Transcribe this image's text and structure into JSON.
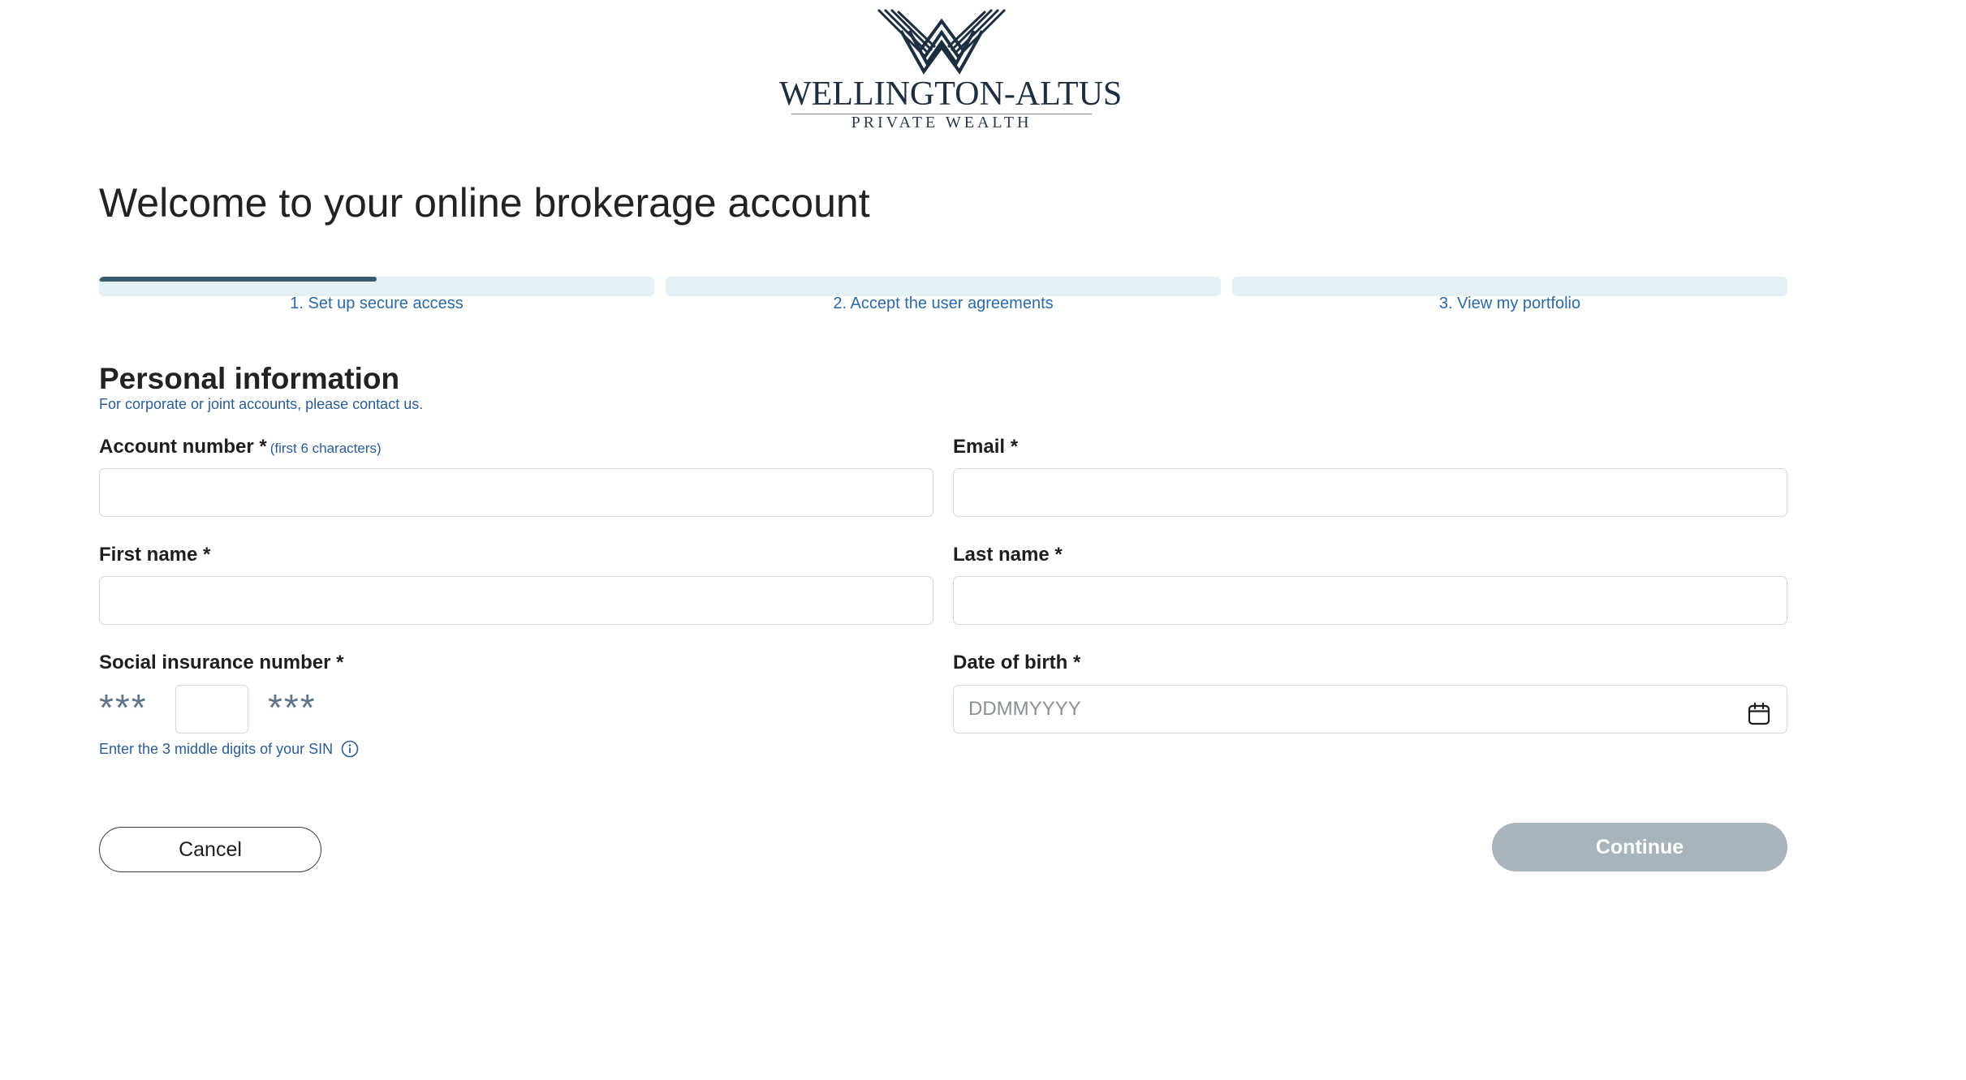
{
  "brand": {
    "name": "WELLINGTON-ALTUS",
    "tagline": "PRIVATE WEALTH",
    "logo_icon": "interlaced-chevron-logo",
    "color_primary": "#1c2e40"
  },
  "page": {
    "title": "Welcome to your online brokerage account"
  },
  "stepper": {
    "progress_color": "#3c5a6e",
    "track_color": "#e4f1f4",
    "steps": [
      {
        "label": "1. Set up secure access",
        "progress": 0.5
      },
      {
        "label": "2. Accept the user agreements",
        "progress": 0
      },
      {
        "label": "3. View my portfolio",
        "progress": 0
      }
    ]
  },
  "section": {
    "title": "Personal information",
    "note": "For corporate or joint accounts, please contact us."
  },
  "form": {
    "account_number": {
      "label": "Account number *",
      "hint": "(first 6 characters)",
      "value": "",
      "placeholder": ""
    },
    "email": {
      "label": "Email *",
      "value": "",
      "placeholder": ""
    },
    "first_name": {
      "label": "First name *",
      "value": "",
      "placeholder": ""
    },
    "last_name": {
      "label": "Last name *",
      "value": "",
      "placeholder": ""
    },
    "sin": {
      "label": "Social insurance number *",
      "mask_left": "***",
      "mask_right": "***",
      "value": "",
      "help": "Enter the 3 middle digits of your SIN",
      "help_icon": "info-icon"
    },
    "dob": {
      "label": "Date of birth *",
      "value": "",
      "placeholder": "DDMMYYYY",
      "icon": "calendar-icon"
    }
  },
  "actions": {
    "cancel_label": "Cancel",
    "continue_label": "Continue",
    "continue_disabled_color": "#a7b4bc"
  }
}
